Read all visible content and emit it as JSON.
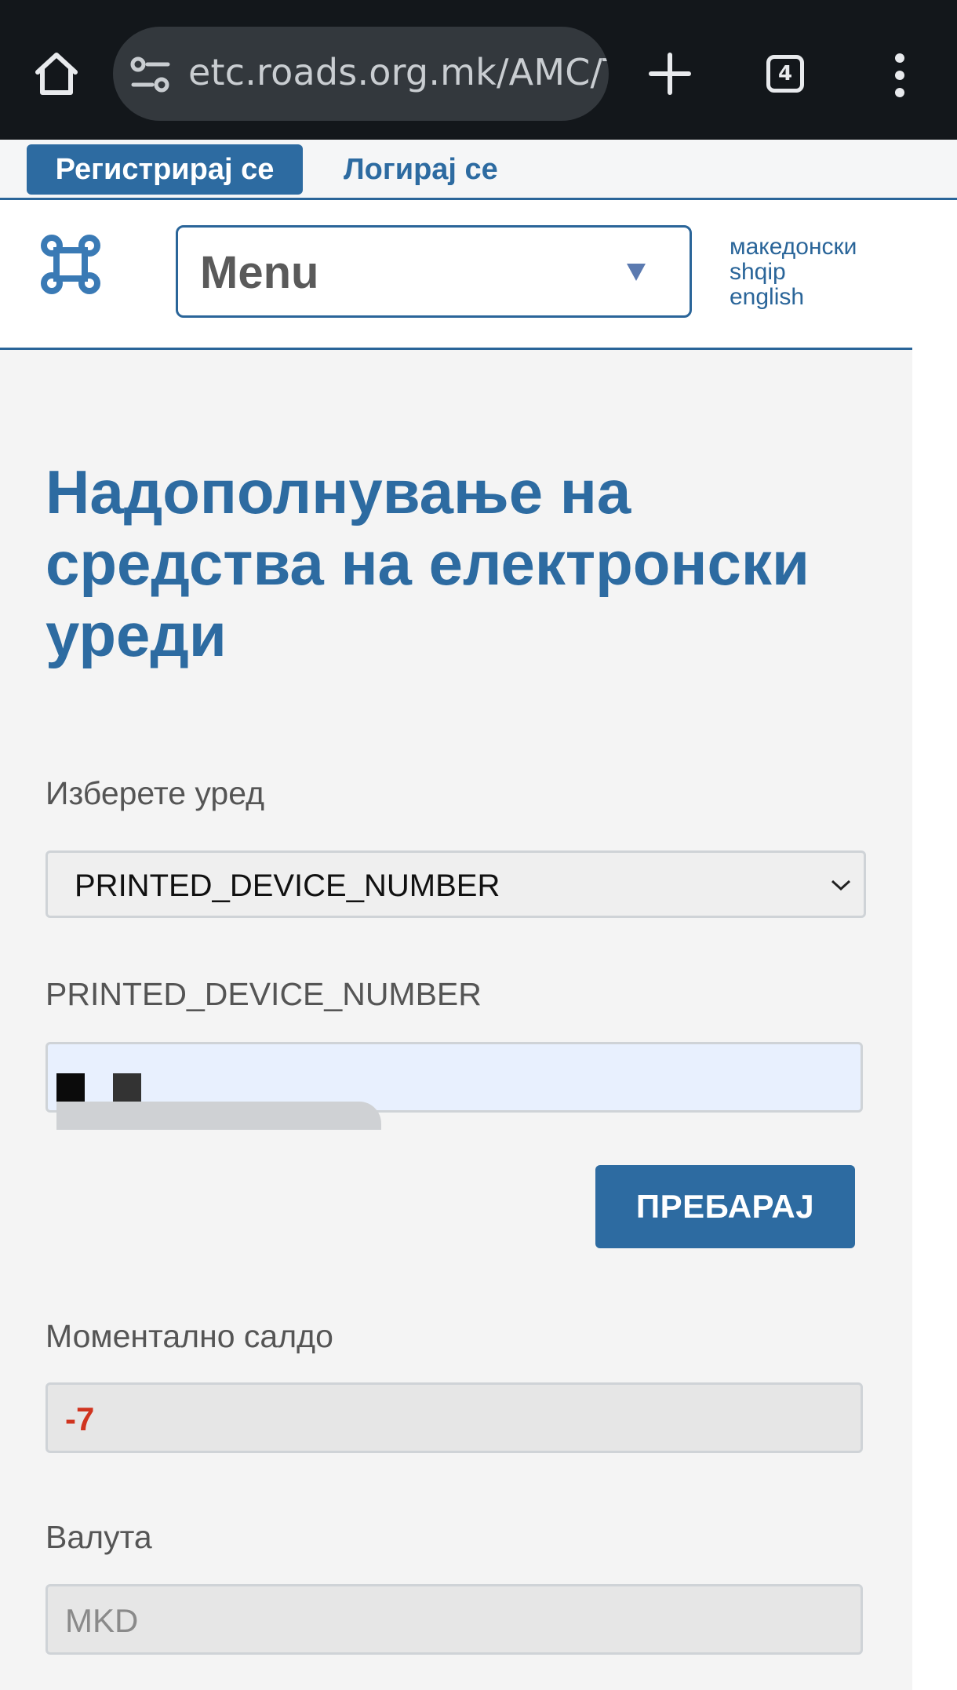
{
  "browser": {
    "url": "etc.roads.org.mk/AMC/Т",
    "tab_count": "4",
    "icons": [
      "home-icon",
      "tune-icon",
      "plus-icon",
      "tabs-icon",
      "more-vert-icon"
    ]
  },
  "auth": {
    "register_label": "Регистрирај се",
    "login_label": "Логирај се"
  },
  "header": {
    "menu_label": "Menu",
    "languages": [
      "македонски",
      "shqip",
      "english"
    ]
  },
  "main": {
    "title": "Надополнување на средства на електронски уреди",
    "select_device_label": "Изберете уред",
    "select_device_value": "PRINTED_DEVICE_NUMBER",
    "device_number_label": "PRINTED_DEVICE_NUMBER",
    "search_label": "ПРЕБАРАЈ",
    "balance_label": "Моментално салдо",
    "balance_value": "-7",
    "currency_label": "Валута",
    "currency_value": "MKD"
  },
  "colors": {
    "brand_blue": "#2d6ba1",
    "negative_red": "#d0341f",
    "browser_bg": "#13171b"
  }
}
